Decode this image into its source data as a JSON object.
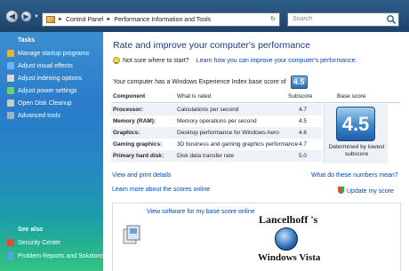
{
  "address_bar": {
    "crumbs": [
      "Control Panel",
      "Performance Information and Tools"
    ],
    "search_placeholder": "Search"
  },
  "sidebar": {
    "tasks_title": "Tasks",
    "items": [
      {
        "label": "Manage startup programs",
        "icon": "startup-icon",
        "color": "#e8b23a"
      },
      {
        "label": "Adjust visual effects",
        "icon": "visual-effects-icon",
        "color": "#6fb6f0"
      },
      {
        "label": "Adjust indexing options",
        "icon": "indexing-icon",
        "color": "#d9d9d9"
      },
      {
        "label": "Adjust power settings",
        "icon": "power-icon",
        "color": "#6fce6f"
      },
      {
        "label": "Open Disk Cleanup",
        "icon": "disk-cleanup-icon",
        "color": "#c9c9c9"
      },
      {
        "label": "Advanced tools",
        "icon": "advanced-tools-icon",
        "color": "#9fb3c7"
      }
    ],
    "see_also_title": "See also",
    "see_also": [
      {
        "label": "Security Center",
        "icon": "security-center-icon",
        "color": "#e34a3a"
      },
      {
        "label": "Problem Reports and Solutions",
        "icon": "problem-reports-icon",
        "color": "#4fa7e0"
      }
    ]
  },
  "main": {
    "heading": "Rate and improve your computer's performance",
    "tip_text": "Not sure where to start?",
    "tip_link": "Learn how you can improve your computer's performance.",
    "base_score_text": "Your computer has a Windows Experience Index base score of",
    "base_score": "4.5",
    "table": {
      "headers": {
        "component": "Component",
        "rated": "What is rated",
        "subscore": "Subscore",
        "base": "Base score"
      },
      "rows": [
        {
          "component": "Processor:",
          "rated": "Calculations per second",
          "subscore": "4.7"
        },
        {
          "component": "Memory (RAM):",
          "rated": "Memory operations per second",
          "subscore": "4.5"
        },
        {
          "component": "Graphics:",
          "rated": "Desktop performance for Windows Aero",
          "subscore": "4.6"
        },
        {
          "component": "Gaming graphics:",
          "rated": "3D business and gaming graphics performance",
          "subscore": "4.7"
        },
        {
          "component": "Primary hard disk:",
          "rated": "Disk data transfer rate",
          "subscore": "5.0"
        }
      ],
      "base_score_big": "4.5",
      "determined_by": "Determined by lowest subscore"
    },
    "links": {
      "view_print": "View and print details",
      "what_numbers": "What do these numbers mean?",
      "learn_scores": "Learn more about the scores online",
      "update_score": "Update my score"
    },
    "lower": {
      "software_link": "View software for my base score online",
      "brand_title": "Lancelhoff 's",
      "brand_name": "Windows Vista"
    }
  }
}
